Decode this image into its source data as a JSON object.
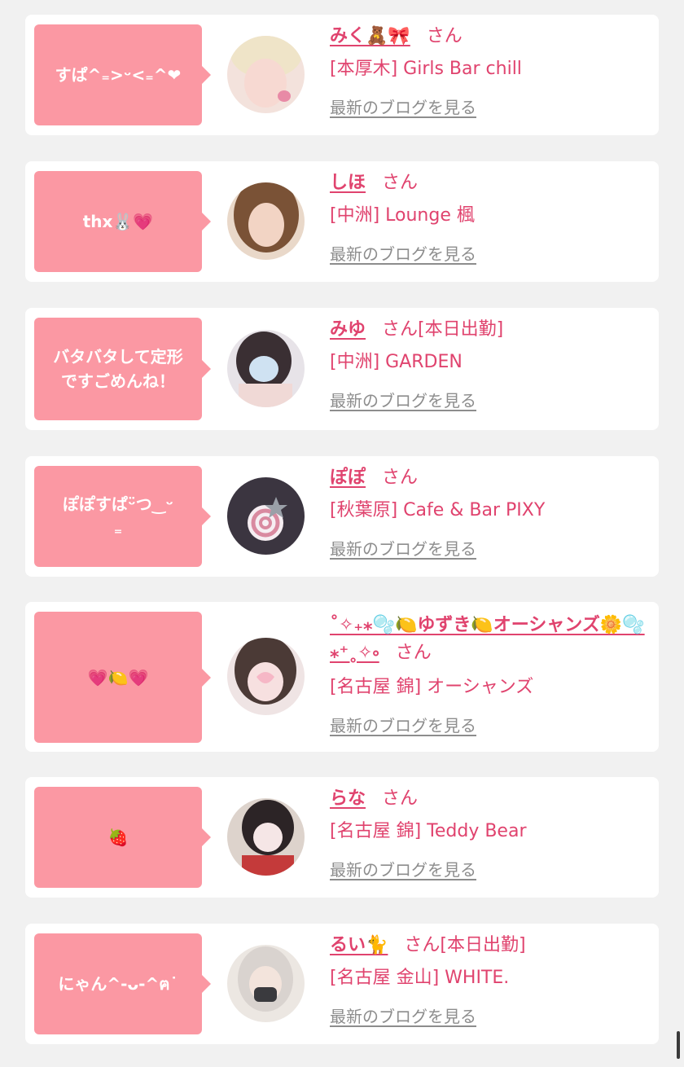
{
  "blog_label": "最新のブログを見る",
  "honorific": "さん",
  "entries": [
    {
      "comment": "すぱ^₌>ᵕ<₌^❤",
      "name": "みく🧸🎀",
      "suffix": "",
      "shop": "[本厚木] Girls Bar chill"
    },
    {
      "comment": "thx🐰💗",
      "name": "しほ",
      "suffix": "",
      "shop": "[中洲] Lounge 楓"
    },
    {
      "comment": "バタバタして定形\nですごめんね！",
      "name": "みゆ",
      "suffix": "[本日出勤]",
      "shop": "[中洲] GARDEN"
    },
    {
      "comment": "ぽぽすぱᵕ̈つ‿ᵕ\n₌",
      "name": "ぽぽ",
      "suffix": "",
      "shop": "[秋葉原] Cafe & Bar PIXY"
    },
    {
      "comment": "💗🍋💗",
      "name": "˚✧₊⁎🫧🍋ゆずき🍋オーシャンズ🌼🫧⁎⁺˳✧༚",
      "suffix": "",
      "shop": "[名古屋 錦] オーシャンズ"
    },
    {
      "comment": "🍓",
      "name": "らな",
      "suffix": "",
      "shop": "[名古屋 錦] Teddy Bear"
    },
    {
      "comment": "にゃん^-ᴗ-^ฅ˙",
      "name": "るい🐈",
      "suffix": "[本日出勤]",
      "shop": "[名古屋 金山] WHITE."
    }
  ]
}
